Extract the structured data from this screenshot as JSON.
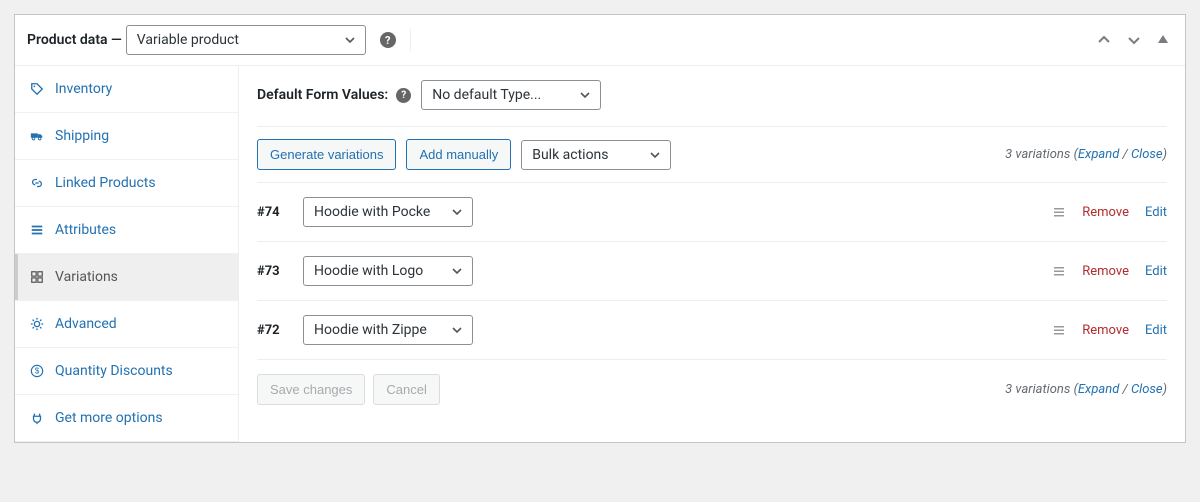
{
  "header": {
    "title_prefix": "Product data",
    "dash": " — ",
    "type_select": "Variable product",
    "chevUp": "up",
    "chevDown": "down",
    "triangle": "collapse"
  },
  "sidebar": {
    "items": [
      {
        "label": "Inventory",
        "active": false
      },
      {
        "label": "Shipping",
        "active": false
      },
      {
        "label": "Linked Products",
        "active": false
      },
      {
        "label": "Attributes",
        "active": false
      },
      {
        "label": "Variations",
        "active": true
      },
      {
        "label": "Advanced",
        "active": false
      },
      {
        "label": "Quantity Discounts",
        "active": false
      },
      {
        "label": "Get more options",
        "active": false
      }
    ]
  },
  "main": {
    "default_form_label": "Default Form Values:",
    "default_form_select": "No default Type...",
    "toolbar": {
      "generate": "Generate variations",
      "add_manually": "Add manually",
      "bulk_actions": "Bulk actions",
      "count_text": "3 variations",
      "expand": "Expand",
      "close": "Close"
    },
    "variations": [
      {
        "id": "#74",
        "value": "Hoodie with Pocke"
      },
      {
        "id": "#73",
        "value": "Hoodie with Logo"
      },
      {
        "id": "#72",
        "value": "Hoodie with Zippe"
      }
    ],
    "actions": {
      "remove": "Remove",
      "edit": "Edit"
    },
    "footer": {
      "save": "Save changes",
      "cancel": "Cancel",
      "count_text": "3 variations",
      "expand": "Expand",
      "close": "Close"
    }
  }
}
